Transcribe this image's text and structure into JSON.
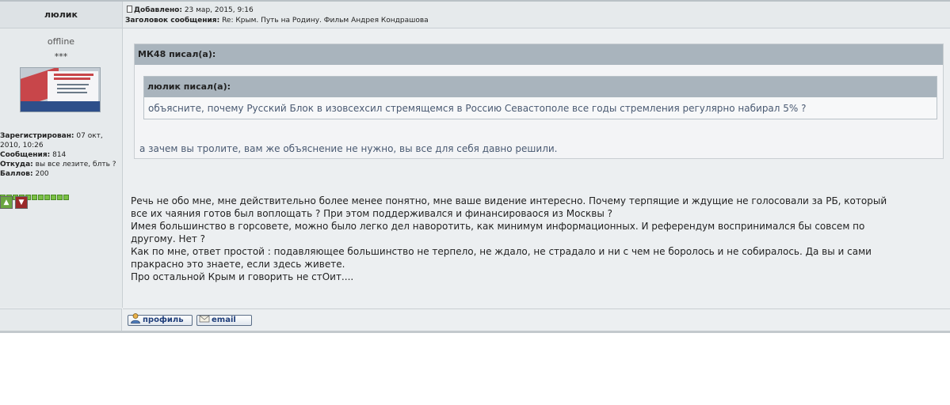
{
  "author": {
    "name": "люлик",
    "status": "offline",
    "stars": "***",
    "registered_label": "Зарегистрирован:",
    "registered_value": "07 окт, 2010, 10:26",
    "posts_label": "Сообщения:",
    "posts_value": "814",
    "from_label": "Откуда:",
    "from_value": "вы все лезите, блть ?",
    "points_label": "Баллов:",
    "points_value": "200",
    "rating_pips": 11
  },
  "post_header": {
    "added_label": "Добавлено:",
    "added_value": "23 мар, 2015, 9:16",
    "subject_label": "Заголовок сообщения:",
    "subject_value": "Re: Крым. Путь на Родину. Фильм Андрея Кондрашова"
  },
  "quote_outer": {
    "header": "МК48 писал(а):",
    "text": "а зачем вы тролите, вам же объяснение не нужно, вы все для себя давно решили."
  },
  "quote_inner": {
    "header": "люлик писал(а):",
    "text": "объясните, почему Русский Блок в изовсехсил стремящемся в Россию Севастополе все годы стремления регулярно набирал 5% ?"
  },
  "body_lines": [
    "Речь не обо мне, мне действительно более менее понятно, мне ваше видение интересно. Почему терпящие и ждущие не голосовали за РБ, который",
    "все их чаяния готов был воплощать ? При этом поддерживался и финансироваося из Москвы ?",
    "Имея большинство в горсовете, можно было легко дел наворотить, как минимум информационных. И референдум воспринимался бы совсем по",
    "другому. Нет ?",
    "Как по мне, ответ простой : подавляющее большинство не терпело, не ждало, не страдало и ни с чем не боролось и не собиралось. Да вы и сами",
    "пракрасно это знаете, если здесь живете.",
    "Про остальной Крым и говорить не стОит...."
  ],
  "footer": {
    "profile_label": "профиль",
    "email_label": "email"
  },
  "colors": {
    "quote_header": "#a9b4bd",
    "rating_green": "#7bc045",
    "vote_down": "#9a2a2a",
    "button_text": "#1f3e7a"
  }
}
